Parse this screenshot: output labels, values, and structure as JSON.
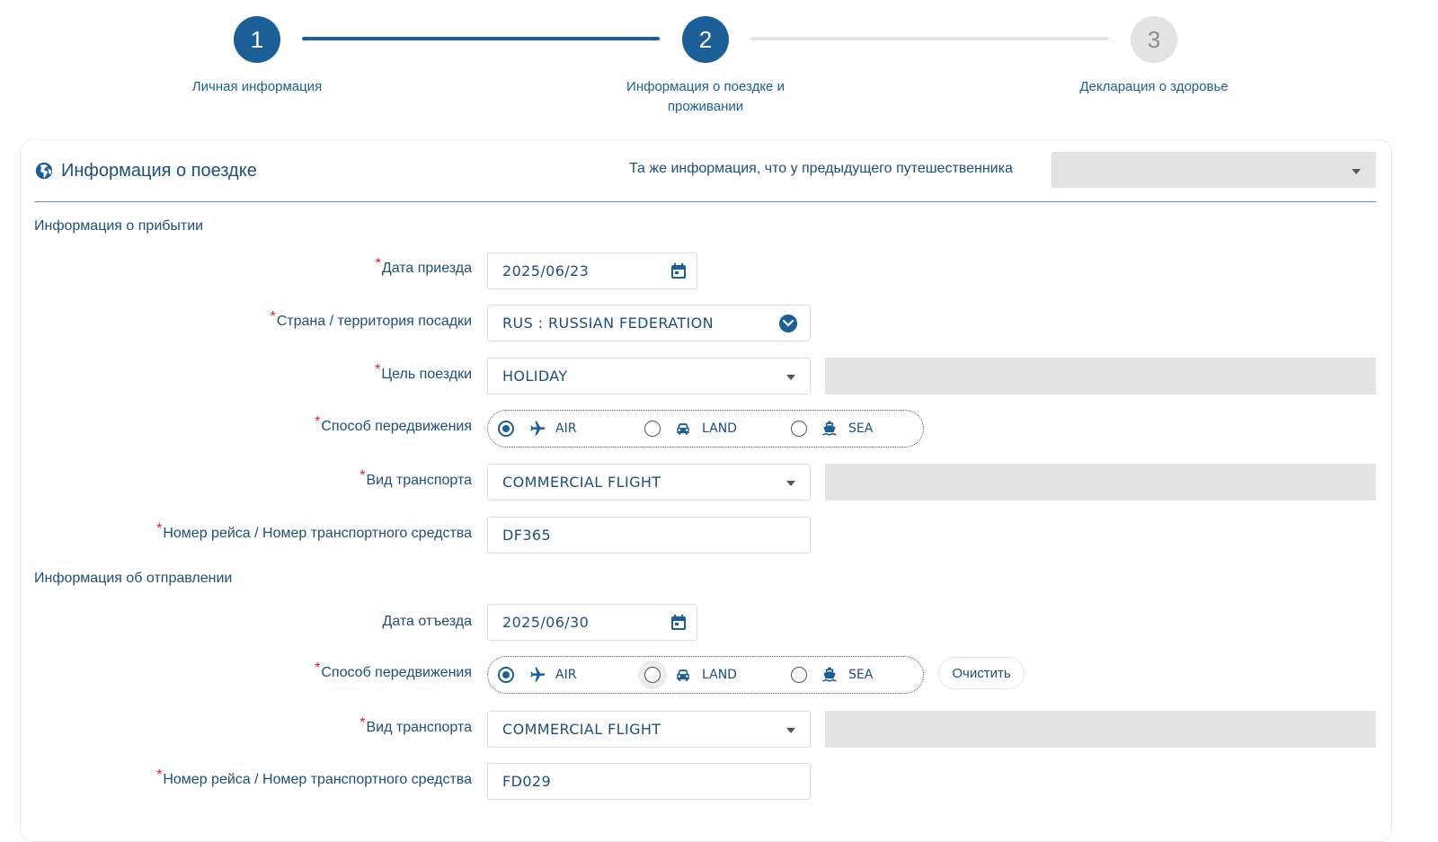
{
  "stepper": {
    "steps": [
      {
        "number": "1",
        "label": "Личная информация",
        "state": "done"
      },
      {
        "number": "2",
        "label_line1": "Информация о поездке и",
        "label_line2": "проживании",
        "state": "active"
      },
      {
        "number": "3",
        "label": "Декларация о здоровье",
        "state": "pending"
      }
    ]
  },
  "card": {
    "title": "Информация о поездке",
    "title_icon": "globe-icon",
    "copy_label": "Та же информация, что у предыдущего путешественника",
    "copy_select_value": ""
  },
  "arrival": {
    "section_title": "Информация о прибытии",
    "date_label": "Дата приезда",
    "date_value": "2025/06/23",
    "country_label": "Страна / территория посадки",
    "country_value": "RUS : RUSSIAN FEDERATION",
    "purpose_label": "Цель поездки",
    "purpose_value": "HOLIDAY",
    "mode_label": "Способ передвижения",
    "modes": [
      "AIR",
      "LAND",
      "SEA"
    ],
    "mode_selected": "AIR",
    "transport_label": "Вид транспорта",
    "transport_value": "COMMERCIAL FLIGHT",
    "flight_label": "Номер рейса / Номер транспортного средства",
    "flight_value": "DF365"
  },
  "departure": {
    "section_title": "Информация об отправлении",
    "date_label": "Дата отъезда",
    "date_value": "2025/06/30",
    "mode_label": "Способ передвижения",
    "modes": [
      "AIR",
      "LAND",
      "SEA"
    ],
    "mode_selected": "AIR",
    "clear_label": "Очистить",
    "transport_label": "Вид транспорта",
    "transport_value": "COMMERCIAL FLIGHT",
    "flight_label": "Номер рейса / Номер транспортного средства",
    "flight_value": "FD029"
  },
  "required_mark": "*",
  "colors": {
    "primary": "#1c5f96",
    "text": "#1f4e79",
    "required": "#e02020",
    "disabled": "#e3e3e3"
  }
}
